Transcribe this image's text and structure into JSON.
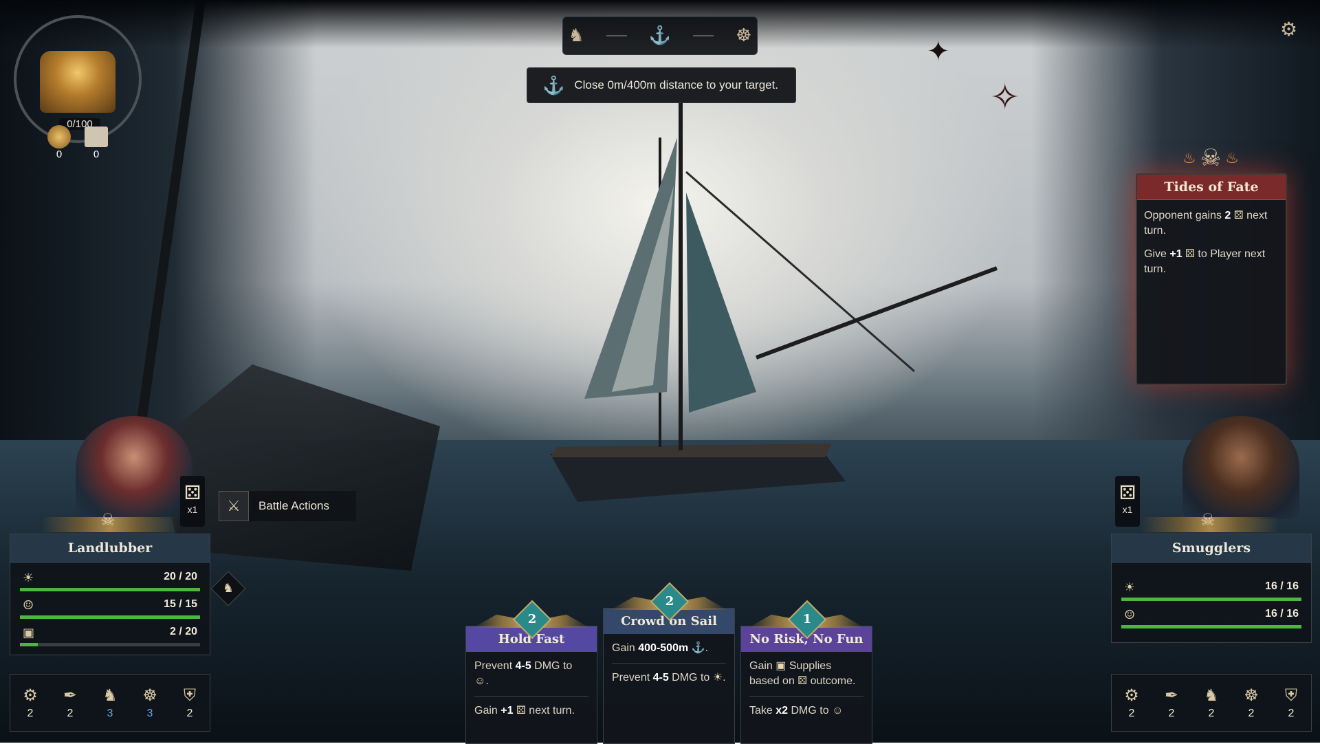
{
  "hud": {
    "steps": [
      "parrot-icon",
      "sextant-icon",
      "ship-wheel-icon"
    ],
    "objective": "Close 0m/400m distance to your target."
  },
  "treasure": {
    "count": "0/100",
    "gold": "0",
    "supplies": "0"
  },
  "tides_of_fate": {
    "title": "Tides of Fate",
    "line1": {
      "pre": "Opponent gains ",
      "num": "2",
      "post": " next turn."
    },
    "line2": {
      "pre": "Give ",
      "num": "+1",
      "post": " to Player next turn."
    }
  },
  "player": {
    "name": "Landlubber",
    "dice_mult": "x1",
    "battle_actions": "Battle Actions",
    "bars": [
      {
        "icon": "heart-sun-icon",
        "value": "20 / 20",
        "fill": 1.0
      },
      {
        "icon": "crew-icon",
        "value": "15 / 15",
        "fill": 1.0
      },
      {
        "icon": "supplies-icon",
        "value": "2 / 20",
        "fill": 0.1
      }
    ],
    "skills": [
      {
        "icon": "sextant-skill-icon",
        "value": "2",
        "color": "#f0ead8"
      },
      {
        "icon": "quill-skill-icon",
        "value": "2",
        "color": "#f0ead8"
      },
      {
        "icon": "parrot-skill-icon",
        "value": "3",
        "color": "#6aa7e8"
      },
      {
        "icon": "helm-skill-icon",
        "value": "3",
        "color": "#6aa7e8"
      },
      {
        "icon": "shield-skill-icon",
        "value": "2",
        "color": "#f0ead8"
      }
    ]
  },
  "opponent": {
    "name": "Smugglers",
    "dice_mult": "x1",
    "bars": [
      {
        "icon": "heart-sun-icon",
        "value": "16 / 16",
        "fill": 1.0
      },
      {
        "icon": "crew-icon",
        "value": "16 / 16",
        "fill": 1.0
      }
    ],
    "skills": [
      {
        "icon": "sextant-skill-icon",
        "value": "2"
      },
      {
        "icon": "quill-skill-icon",
        "value": "2"
      },
      {
        "icon": "parrot-skill-icon",
        "value": "2"
      },
      {
        "icon": "helm-skill-icon",
        "value": "2"
      },
      {
        "icon": "shield-skill-icon",
        "value": "2"
      }
    ]
  },
  "cards": [
    {
      "title": "Hold Fast",
      "cost": "2",
      "lines": [
        {
          "pre": "Prevent ",
          "b": "4-5",
          "post": " DMG to ",
          "icon": "crew-icon",
          "end": "."
        },
        {
          "pre": "Gain ",
          "b": "+1",
          "post": " ",
          "icon": "die-icon",
          "end": " next turn."
        }
      ]
    },
    {
      "title": "Crowd on Sail",
      "cost": "2",
      "lines": [
        {
          "pre": "Gain ",
          "b": "400-500m",
          "post": " ",
          "icon": "sextant-icon",
          "end": "."
        },
        {
          "pre": "Prevent ",
          "b": "4-5",
          "post": " DMG to ",
          "icon": "heart-sun-icon",
          "end": "."
        }
      ]
    },
    {
      "title": "No Risk, No Fun",
      "cost": "1",
      "lines": [
        {
          "pre": "Gain ",
          "b": "",
          "post": "",
          "icon": "supplies-icon",
          "end": " Supplies based on ",
          "icon2": "die-icon",
          "end2": " outcome."
        },
        {
          "pre": "Take ",
          "b": "x2",
          "post": " DMG to ",
          "icon": "crew-icon",
          "end": ""
        }
      ]
    }
  ]
}
